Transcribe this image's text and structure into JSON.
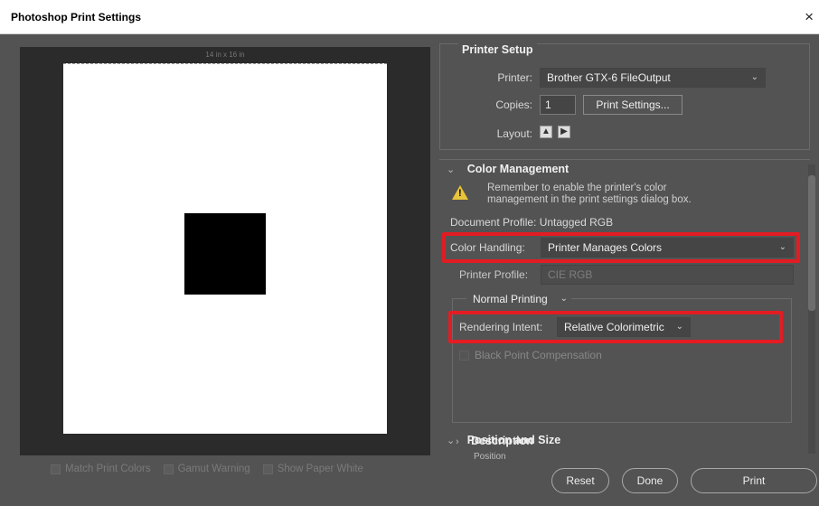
{
  "window": {
    "title": "Photoshop Print Settings",
    "close_label": "×"
  },
  "preview": {
    "paper_size_label": "14 in x 16 in",
    "options": [
      {
        "label": "Match Print Colors"
      },
      {
        "label": "Gamut Warning"
      },
      {
        "label": "Show Paper White"
      }
    ]
  },
  "printer_setup": {
    "title": "Printer Setup",
    "printer_label": "Printer:",
    "printer_value": "Brother GTX-6 FileOutput",
    "copies_label": "Copies:",
    "copies_value": "1",
    "print_settings_button": "Print Settings...",
    "layout_label": "Layout:"
  },
  "color_management": {
    "title": "Color Management",
    "warning_line1": "Remember to enable the printer's color",
    "warning_line2": "management in the print settings dialog box.",
    "document_profile": "Document Profile: Untagged RGB",
    "color_handling_label": "Color Handling:",
    "color_handling_value": "Printer Manages Colors",
    "printer_profile_label": "Printer Profile:",
    "printer_profile_value": "CIE RGB",
    "normal_printing": "Normal Printing",
    "rendering_intent_label": "Rendering Intent:",
    "rendering_intent_value": "Relative Colorimetric",
    "black_point_label": "Black Point Compensation"
  },
  "description": {
    "title": "Description"
  },
  "position_size": {
    "title": "Position and Size",
    "sub_label": "Position"
  },
  "footer": {
    "reset_label": "Reset",
    "done_label": "Done",
    "print_label": "Print"
  },
  "colors": {
    "highlight": "#e31c23",
    "warning": "#e8c43a",
    "panel": "#535353"
  }
}
